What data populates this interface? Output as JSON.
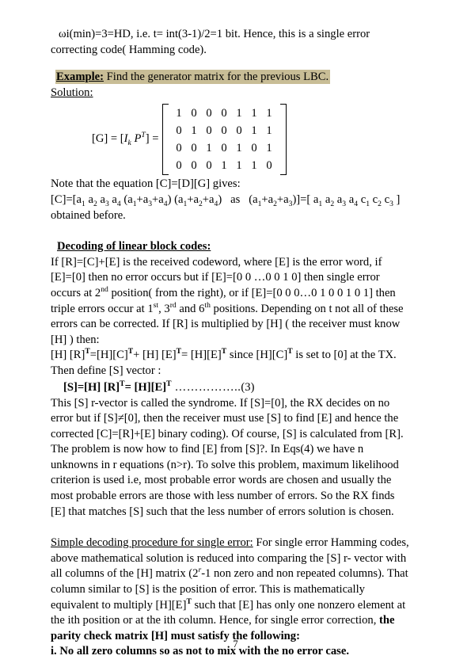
{
  "document": {
    "page_number": "7",
    "highlight_color": "#c8bd96",
    "intro": {
      "line1": "ωi(min)=3=HD, i.e. t= int(3-1)/2=1 bit. Hence, this is a single error",
      "line2": "correcting code( Hamming code)."
    },
    "example": {
      "label": "Example:",
      "text": " Find the generator matrix for the previous LBC.",
      "solution_label": "Solution:"
    },
    "generator": {
      "lhs_prefix": "[G] = [",
      "lhs_ik": "I",
      "lhs_ik_sub": "k",
      "lhs_pt": "P",
      "lhs_pt_sup": "T",
      "lhs_suffix": "] =",
      "matrix": [
        [
          "1",
          "0",
          "0",
          "0",
          "1",
          "1",
          "1"
        ],
        [
          "0",
          "1",
          "0",
          "0",
          "0",
          "1",
          "1"
        ],
        [
          "0",
          "0",
          "1",
          "0",
          "1",
          "0",
          "1"
        ],
        [
          "0",
          "0",
          "0",
          "1",
          "1",
          "1",
          "0"
        ]
      ]
    },
    "note": {
      "line1": "Note that the equation [C]=[D][G] gives:",
      "line2_a": "[C]=[a",
      "line2_b": " a",
      "line2_c": " a",
      "line2_d": " a",
      "line2_full": "[C]=[a1 a2 a3 a4 (a1+a3+a4) (a1+a2+a4)   as   (a1+a2+a3)]=[ a1 a2 a3 a4 c1 c2 c3 ]",
      "line3": "obtained before."
    },
    "decoding": {
      "heading": "Decoding of linear block codes:",
      "p1_line1": "If [R]=[C]+[E] is the received codeword, where [E] is the error word, if",
      "p1_line2_pre": "[E]=[0] then no error occurs but if [E]=[0 0 …0 0 1 0] then single error",
      "p1_line3_pre": "occurs at 2",
      "p1_line3_sup": "nd",
      "p1_line3_post": " position( from the right), or if [E]=[0 0 0…0 1 0 0 1 0 1] then",
      "p1_line4_a": "triple errors occur at 1",
      "p1_line4_sup1": "st",
      "p1_line4_b": ", 3",
      "p1_line4_sup2": "rd",
      "p1_line4_c": " and 6",
      "p1_line4_sup3": "th",
      "p1_line4_d": " positions. Depending on t not all of these",
      "p1_line5": "errors can be corrected. If [R] is multiplied by [H] ( the receiver must know",
      "p1_line6": "[H] ) then:",
      "hline_a": "  [H] [R]",
      "hline_sup1": "T",
      "hline_b": "=[H][C]",
      "hline_sup2": "T",
      "hline_c": "+ [H] [E]",
      "hline_sup3": "T",
      "hline_d": "= [H][E]",
      "hline_sup4": "T",
      "hline_e": " since [H][C]",
      "hline_sup5": "T",
      "hline_f": " is set to [0] at the TX.",
      "define_line": "Then define [S] vector :",
      "eq_a": "[S]=[H] [R]",
      "eq_sup1": "T",
      "eq_b": "= [H][E]",
      "eq_sup2": "T",
      "eq_dots": " ……………..",
      "eq_num": "(3)",
      "p2_line1": "   This [S] r-vector is called the syndrome. If [S]=[0], the RX decides on no",
      "p2_line2": "error but if [S]≠[0], then the receiver must use [S] to find [E] and hence the",
      "p2_line3": "corrected [C]=[R]+[E] binary coding). Of course, [S] is calculated from [R].",
      "p2_line4": "The problem is now how to find [E] from [S]?. In Eqs(4) we have n",
      "p2_line5": "unknowns in r equations (n>r). To solve this problem, maximum likelihood",
      "p2_line6": "criterion is used i.e, most probable error words are chosen and usually the",
      "p2_line7": "most probable errors are those with less number of errors. So the RX finds",
      "p2_line8": "[E]  that matches [S] such that the less number of errors solution is  chosen."
    },
    "simple": {
      "heading": "Simple decoding procedure for single error:",
      "line1_rest": " For single error Hamming  codes,",
      "line2": "above mathematical solution is reduced into comparing the [S] r-  vector with",
      "line3_a": "all columns of the [H] matrix (2",
      "line3_sup": "r",
      "line3_b": "-1 non zero and non repeated  columns). That",
      "line4": "column  similar  to  [S]  is  the  position  of  error.  This  is   mathematically",
      "line5_a": "equivalent to multiply [H][E]",
      "line5_sup": "T",
      "line5_b": " such that [E] has only one  nonzero element at",
      "line6_a": "the ith position or at the ith column. Hence, for  single  error correction, ",
      "line6_bold": "the",
      "line7_bold": "parity check matrix [H] must satisfy the following:",
      "line8_bold": " i. No all zero columns so as not to mix with the no error case."
    }
  }
}
